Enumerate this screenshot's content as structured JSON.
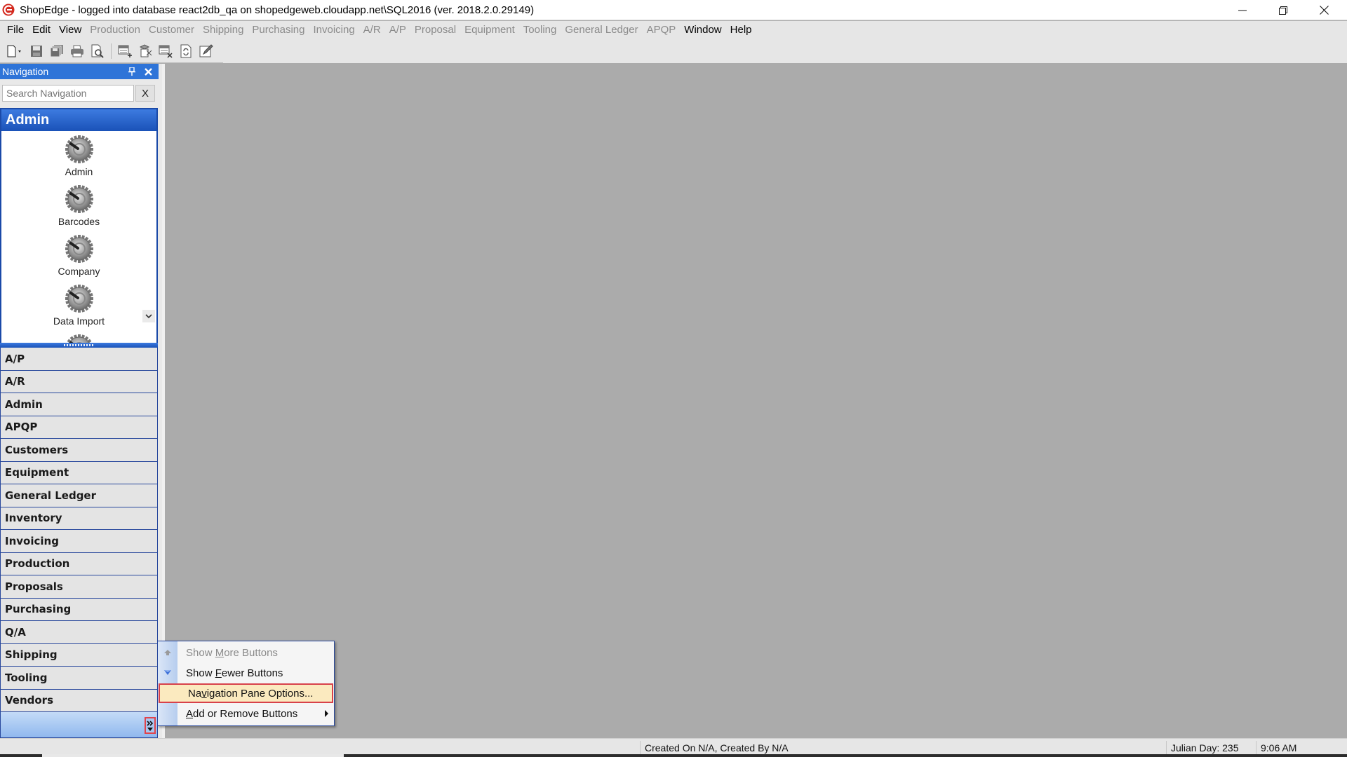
{
  "window": {
    "title": "ShopEdge -  logged into database react2db_qa on shopedgeweb.cloudapp.net\\SQL2016 (ver. 2018.2.0.29149)",
    "controls": {
      "minimize": "minimize-icon",
      "restore": "restore-icon",
      "close": "close-icon"
    }
  },
  "menubar": {
    "items": [
      {
        "label": "File",
        "enabled": true
      },
      {
        "label": "Edit",
        "enabled": true
      },
      {
        "label": "View",
        "enabled": true
      },
      {
        "label": "Production",
        "enabled": false
      },
      {
        "label": "Customer",
        "enabled": false
      },
      {
        "label": "Shipping",
        "enabled": false
      },
      {
        "label": "Purchasing",
        "enabled": false
      },
      {
        "label": "Invoicing",
        "enabled": false
      },
      {
        "label": "A/R",
        "enabled": false
      },
      {
        "label": "A/P",
        "enabled": false
      },
      {
        "label": "Proposal",
        "enabled": false
      },
      {
        "label": "Equipment",
        "enabled": false
      },
      {
        "label": "Tooling",
        "enabled": false
      },
      {
        "label": "General Ledger",
        "enabled": false
      },
      {
        "label": "APQP",
        "enabled": false
      },
      {
        "label": "Window",
        "enabled": true
      },
      {
        "label": "Help",
        "enabled": true
      }
    ]
  },
  "toolbar": {
    "buttons": [
      "new-document-icon",
      "save-icon",
      "save-all-icon",
      "print-icon",
      "print-preview-icon",
      "add-record-icon",
      "copy-record-icon",
      "delete-record-icon",
      "refresh-icon",
      "edit-icon"
    ]
  },
  "navigation": {
    "title": "Navigation",
    "search": {
      "placeholder": "Search Navigation",
      "value": "",
      "clear_label": "X"
    },
    "active_group": {
      "title": "Admin",
      "items": [
        {
          "label": "Admin",
          "icon": "gear-icon"
        },
        {
          "label": "Barcodes",
          "icon": "gear-icon"
        },
        {
          "label": "Company",
          "icon": "gear-icon"
        },
        {
          "label": "Data Import",
          "icon": "gear-icon"
        }
      ]
    },
    "sections": [
      {
        "label": "A/P"
      },
      {
        "label": "A/R"
      },
      {
        "label": "Admin"
      },
      {
        "label": "APQP"
      },
      {
        "label": "Customers"
      },
      {
        "label": "Equipment"
      },
      {
        "label": "General Ledger"
      },
      {
        "label": "Inventory"
      },
      {
        "label": "Invoicing"
      },
      {
        "label": "Production"
      },
      {
        "label": "Proposals"
      },
      {
        "label": "Purchasing"
      },
      {
        "label": "Q/A"
      },
      {
        "label": "Shipping"
      },
      {
        "label": "Tooling"
      },
      {
        "label": "Vendors"
      }
    ]
  },
  "context_menu": {
    "items": [
      {
        "label": "Show More Buttons",
        "mnemonic": "M",
        "enabled": false,
        "icon": "arrow-up-icon"
      },
      {
        "label": "Show Fewer Buttons",
        "mnemonic": "F",
        "enabled": true,
        "icon": "arrow-down-icon"
      },
      {
        "label": "Navigation Pane Options...",
        "mnemonic": "v",
        "enabled": true,
        "highlighted": true
      },
      {
        "label": "Add or Remove Buttons",
        "mnemonic": "A",
        "enabled": true,
        "submenu": true
      }
    ]
  },
  "statusbar": {
    "created": "Created On N/A, Created By N/A",
    "julian_day": "Julian Day: 235",
    "time": "9:06 AM"
  },
  "colors": {
    "nav_header": "#2e74d8",
    "group_header": "#1a52b8",
    "highlight_border": "#d8414a",
    "highlight_fill": "#fbeabf",
    "mdi_background": "#ababab"
  }
}
